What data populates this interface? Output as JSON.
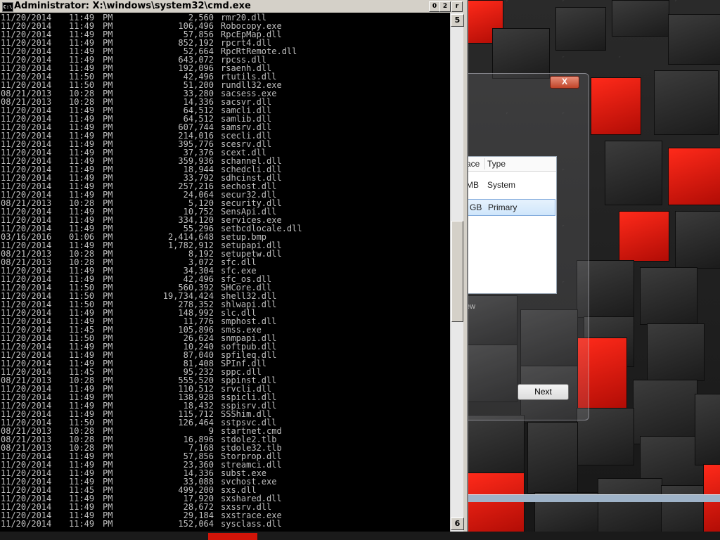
{
  "cmd_window": {
    "title": "Administrator: X:\\windows\\system32\\cmd.exe",
    "icon_text": "C:\\",
    "buttons": {
      "minimize": "0",
      "maximize": "2",
      "close": "r"
    },
    "scroll_up": "5",
    "scroll_down": "6"
  },
  "listing": [
    [
      "11/20/2014",
      "11:49",
      "PM",
      "2,560",
      "rmr20.dll"
    ],
    [
      "11/20/2014",
      "11:49",
      "PM",
      "106,496",
      "Robocopy.exe"
    ],
    [
      "11/20/2014",
      "11:49",
      "PM",
      "57,856",
      "RpcEpMap.dll"
    ],
    [
      "11/20/2014",
      "11:49",
      "PM",
      "852,192",
      "rpcrt4.dll"
    ],
    [
      "11/20/2014",
      "11:49",
      "PM",
      "52,664",
      "RpcRtRemote.dll"
    ],
    [
      "11/20/2014",
      "11:49",
      "PM",
      "643,072",
      "rpcss.dll"
    ],
    [
      "11/20/2014",
      "11:49",
      "PM",
      "192,096",
      "rsaenh.dll"
    ],
    [
      "11/20/2014",
      "11:50",
      "PM",
      "42,496",
      "rtutils.dll"
    ],
    [
      "11/20/2014",
      "11:50",
      "PM",
      "51,200",
      "rundll32.exe"
    ],
    [
      "08/21/2013",
      "10:28",
      "PM",
      "33,280",
      "sacsess.exe"
    ],
    [
      "08/21/2013",
      "10:28",
      "PM",
      "14,336",
      "sacsvr.dll"
    ],
    [
      "11/20/2014",
      "11:49",
      "PM",
      "64,512",
      "samcli.dll"
    ],
    [
      "11/20/2014",
      "11:49",
      "PM",
      "64,512",
      "samlib.dll"
    ],
    [
      "11/20/2014",
      "11:49",
      "PM",
      "607,744",
      "samsrv.dll"
    ],
    [
      "11/20/2014",
      "11:49",
      "PM",
      "214,016",
      "scecli.dll"
    ],
    [
      "11/20/2014",
      "11:49",
      "PM",
      "395,776",
      "scesrv.dll"
    ],
    [
      "11/20/2014",
      "11:49",
      "PM",
      "37,376",
      "scext.dll"
    ],
    [
      "11/20/2014",
      "11:49",
      "PM",
      "359,936",
      "schannel.dll"
    ],
    [
      "11/20/2014",
      "11:49",
      "PM",
      "18,944",
      "schedcli.dll"
    ],
    [
      "11/20/2014",
      "11:49",
      "PM",
      "33,792",
      "sdhcinst.dll"
    ],
    [
      "11/20/2014",
      "11:49",
      "PM",
      "257,216",
      "sechost.dll"
    ],
    [
      "11/20/2014",
      "11:49",
      "PM",
      "24,064",
      "secur32.dll"
    ],
    [
      "08/21/2013",
      "10:28",
      "PM",
      "5,120",
      "security.dll"
    ],
    [
      "11/20/2014",
      "11:49",
      "PM",
      "10,752",
      "SensApi.dll"
    ],
    [
      "11/20/2014",
      "11:49",
      "PM",
      "334,120",
      "services.exe"
    ],
    [
      "11/20/2014",
      "11:49",
      "PM",
      "55,296",
      "setbcdlocale.dll"
    ],
    [
      "03/16/2016",
      "01:06",
      "PM",
      "2,414,648",
      "setup.bmp"
    ],
    [
      "11/20/2014",
      "11:49",
      "PM",
      "1,782,912",
      "setupapi.dll"
    ],
    [
      "08/21/2013",
      "10:28",
      "PM",
      "8,192",
      "setupetw.dll"
    ],
    [
      "08/21/2013",
      "10:28",
      "PM",
      "3,072",
      "sfc.dll"
    ],
    [
      "11/20/2014",
      "11:49",
      "PM",
      "34,304",
      "sfc.exe"
    ],
    [
      "11/20/2014",
      "11:49",
      "PM",
      "42,496",
      "sfc_os.dll"
    ],
    [
      "11/20/2014",
      "11:50",
      "PM",
      "560,392",
      "SHCore.dll"
    ],
    [
      "11/20/2014",
      "11:50",
      "PM",
      "19,734,424",
      "shell32.dll"
    ],
    [
      "11/20/2014",
      "11:50",
      "PM",
      "278,352",
      "shlwapi.dll"
    ],
    [
      "11/20/2014",
      "11:49",
      "PM",
      "148,992",
      "slc.dll"
    ],
    [
      "11/20/2014",
      "11:49",
      "PM",
      "11,776",
      "smphost.dll"
    ],
    [
      "11/20/2014",
      "11:45",
      "PM",
      "105,896",
      "smss.exe"
    ],
    [
      "11/20/2014",
      "11:50",
      "PM",
      "26,624",
      "snmpapi.dll"
    ],
    [
      "11/20/2014",
      "11:49",
      "PM",
      "10,240",
      "softpub.dll"
    ],
    [
      "11/20/2014",
      "11:49",
      "PM",
      "87,040",
      "spfileq.dll"
    ],
    [
      "11/20/2014",
      "11:49",
      "PM",
      "81,408",
      "SPInf.dll"
    ],
    [
      "11/20/2014",
      "11:45",
      "PM",
      "95,232",
      "sppc.dll"
    ],
    [
      "08/21/2013",
      "10:28",
      "PM",
      "555,520",
      "sppinst.dll"
    ],
    [
      "11/20/2014",
      "11:49",
      "PM",
      "110,512",
      "srvcli.dll"
    ],
    [
      "11/20/2014",
      "11:49",
      "PM",
      "138,928",
      "sspicli.dll"
    ],
    [
      "11/20/2014",
      "11:49",
      "PM",
      "18,432",
      "sspisrv.dll"
    ],
    [
      "11/20/2014",
      "11:49",
      "PM",
      "115,712",
      "SSShim.dll"
    ],
    [
      "11/20/2014",
      "11:50",
      "PM",
      "126,464",
      "sstpsvc.dll"
    ],
    [
      "08/21/2013",
      "10:28",
      "PM",
      "9",
      "startnet.cmd"
    ],
    [
      "08/21/2013",
      "10:28",
      "PM",
      "16,896",
      "stdole2.tlb"
    ],
    [
      "08/21/2013",
      "10:28",
      "PM",
      "7,168",
      "stdole32.tlb"
    ],
    [
      "11/20/2014",
      "11:49",
      "PM",
      "57,856",
      "Storprop.dll"
    ],
    [
      "11/20/2014",
      "11:49",
      "PM",
      "23,360",
      "streamci.dll"
    ],
    [
      "11/20/2014",
      "11:49",
      "PM",
      "14,336",
      "subst.exe"
    ],
    [
      "11/20/2014",
      "11:49",
      "PM",
      "33,088",
      "svchost.exe"
    ],
    [
      "11/20/2014",
      "11:45",
      "PM",
      "499,200",
      "sxs.dll"
    ],
    [
      "11/20/2014",
      "11:49",
      "PM",
      "17,920",
      "sxshared.dll"
    ],
    [
      "11/20/2014",
      "11:49",
      "PM",
      "28,672",
      "sxssrv.dll"
    ],
    [
      "11/20/2014",
      "11:49",
      "PM",
      "29,184",
      "sxstrace.exe"
    ],
    [
      "11/20/2014",
      "11:49",
      "PM",
      "152,064",
      "sysclass.dll"
    ]
  ],
  "setup_dialog": {
    "close_label": "X",
    "columns": [
      "ace",
      "Type"
    ],
    "rows": [
      {
        "size_suffix": "MB",
        "type": "System"
      },
      {
        "size_suffix": "GB",
        "type": "Primary"
      }
    ],
    "new_link": "ew",
    "next_label": "Next"
  }
}
